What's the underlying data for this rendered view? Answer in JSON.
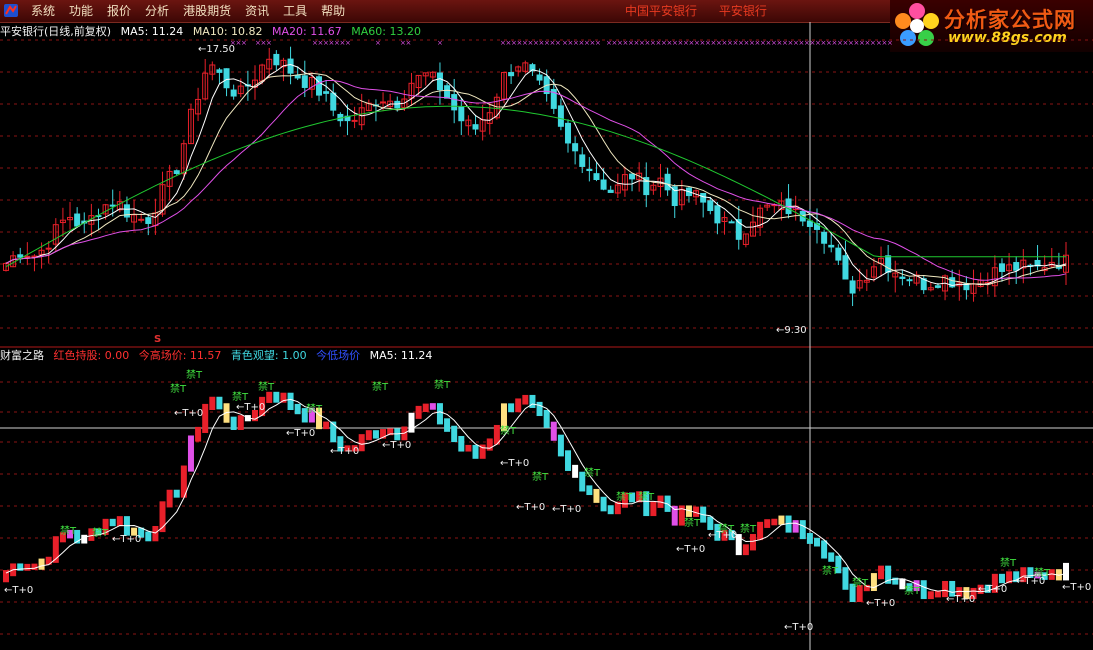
{
  "menu": {
    "items": [
      "系统",
      "功能",
      "报价",
      "分析",
      "港股期货",
      "资讯",
      "工具",
      "帮助"
    ],
    "status": [
      "中国平安银行",
      "平安银行"
    ]
  },
  "logo": {
    "title": "分析家公式网",
    "url": "www.88gs.com"
  },
  "top_panel": {
    "security": "平安银行(日线,前复权)",
    "ma5": "MA5: 11.24",
    "ma10": "MA10: 10.82",
    "ma20": "MA20: 11.67",
    "ma60": "MA60: 13.20",
    "high_label": "17.50",
    "low_label": "9.30"
  },
  "bottom_panel": {
    "indicator": "财富之路",
    "red": "红色持股: 0.00",
    "high": "今高场价: 11.57",
    "cyan": "青色观望: 1.00",
    "low": "今低场价",
    "ma5": "MA5: 11.24",
    "marker_s": "S",
    "ban_text": "禁T",
    "t0_text": "←T+0"
  },
  "colors": {
    "up": "#e8202a",
    "down": "#40d8e0",
    "ma5": "#ffffff",
    "ma10": "#f0e8c0",
    "ma20": "#e050e8",
    "ma60": "#20c830",
    "grid": "#8a1414",
    "ban": "#40e040",
    "red_marker": "#e03030"
  },
  "chart_data": {
    "type": "candlestick",
    "series_name": "平安银行(日线,前复权)",
    "high": 17.5,
    "low": 9.3,
    "ma5_last": 11.24,
    "ma10_last": 10.82,
    "ma20_last": 11.67,
    "ma60_last": 13.2,
    "close_path": [
      11.2,
      11.6,
      11.4,
      12.0,
      12.6,
      12.2,
      12.8,
      13.0,
      12.6,
      12.4,
      13.2,
      14.0,
      15.6,
      17.0,
      16.4,
      16.0,
      16.6,
      17.2,
      16.8,
      16.5,
      16.2,
      15.6,
      15.2,
      15.6,
      16.0,
      15.8,
      16.4,
      16.6,
      16.2,
      15.4,
      15.0,
      15.6,
      16.6,
      17.0,
      16.4,
      15.6,
      14.6,
      14.2,
      13.6,
      13.2,
      13.8,
      13.4,
      13.6,
      13.0,
      13.2,
      12.8,
      12.4,
      12.0,
      12.6,
      12.8,
      12.8,
      12.6,
      12.4,
      11.6,
      10.4,
      10.8,
      11.4,
      11.0,
      10.8,
      10.6,
      10.8,
      10.7,
      10.6,
      10.9,
      11.0,
      11.1,
      11.0,
      11.3,
      11.24
    ]
  }
}
